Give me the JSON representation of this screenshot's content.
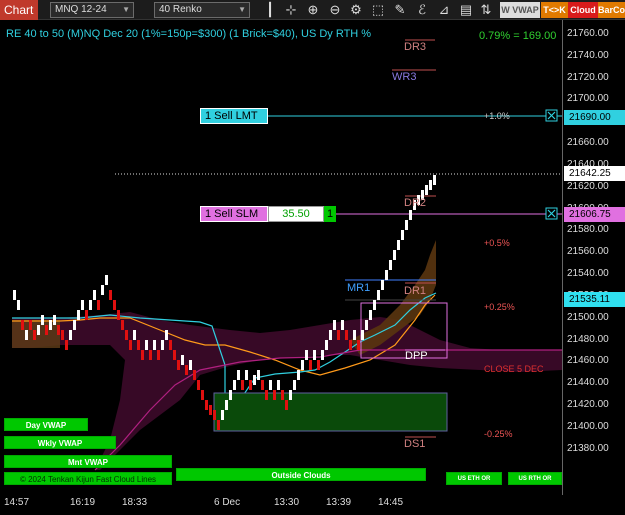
{
  "toolbar": {
    "title": "Chart",
    "instrument": "MNQ 12-24",
    "interval": "40 Renko",
    "w_vwap": "W VWAP",
    "tk": "T<>K",
    "cloud": "Cloud",
    "barco": "BarCo"
  },
  "chart": {
    "header": "RE 40 to 50 (M)NQ Dec 20 (1%=150p=$300) (1 Brick=$40), US Dy RTH %",
    "pnl": "0.79% = 169.00",
    "footer_label": "© 2024 Tenkan Kijun Fast Cloud Lines"
  },
  "price_axis": {
    "ticks": [
      "21760.00",
      "21740.00",
      "21720.00",
      "21700.00",
      "21680.00",
      "21660.00",
      "21640.00",
      "21620.00",
      "21600.00",
      "21580.00",
      "21560.00",
      "21540.00",
      "21520.00",
      "21500.00",
      "21480.00",
      "21460.00",
      "21440.00",
      "21420.00",
      "21400.00",
      "21380.00"
    ],
    "tag_sell_lmt": "21690.00",
    "tag_last": "21642.25",
    "tag_sell_slm": "21606.75",
    "tag_lower": "21535.11"
  },
  "time_axis": [
    "14:57",
    "16:19",
    "18:33",
    "6 Dec",
    "13:30",
    "13:39",
    "14:45"
  ],
  "orders": {
    "sell_lmt": "1 Sell LMT",
    "sell_slm": "1 Sell SLM",
    "slm_price": "35.50",
    "slm_qty": "1"
  },
  "levels": {
    "dr3": "DR3",
    "wr3": "WR3",
    "dr2": "DR2",
    "mr1": "MR1",
    "dr1": "DR1",
    "dpp": "DPP",
    "ds1": "DS1",
    "close": "CLOSE 5 DEC"
  },
  "percents": {
    "p1": "+1.0%",
    "p05": "+0.5%",
    "p025": "+0.25%",
    "m025": "-0.25%"
  },
  "buttons": {
    "day_vwap": "Day VWAP",
    "wkly_vwap": "Wkly VWAP",
    "mnt_vwap": "Mnt VWAP",
    "outside_clouds": "Outside Clouds",
    "us_eth_or": "US ETH OR",
    "us_rth_or": "US RTH OR"
  },
  "colors": {
    "up_brick": "#ffffff",
    "down_brick": "#e01010",
    "cloud_bear": "#3a0a28",
    "cloud_bull": "#5a3510",
    "tenkan": "#30d0e0",
    "kijun": "#ff9a1a"
  }
}
